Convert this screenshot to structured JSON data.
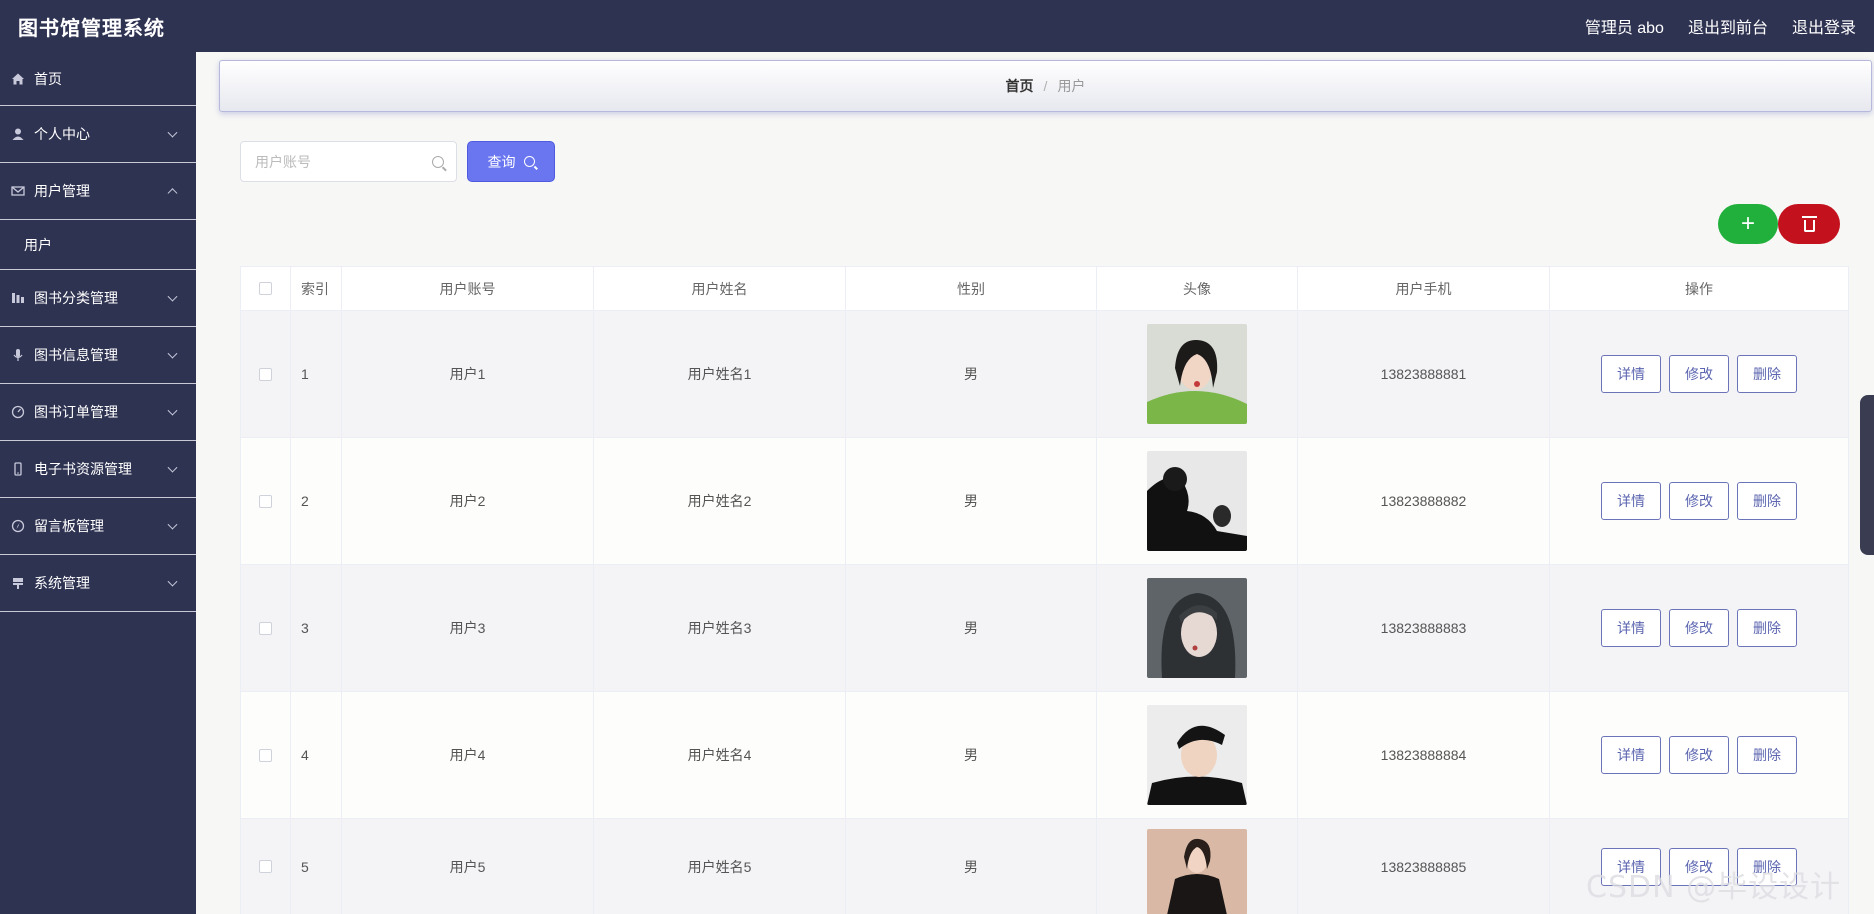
{
  "app": {
    "title": "图书馆管理系统",
    "admin_label": "管理员 abo",
    "to_front": "退出到前台",
    "logout": "退出登录"
  },
  "sidebar": {
    "items": [
      {
        "label": "首页",
        "icon": "home-icon"
      },
      {
        "label": "个人中心",
        "icon": "user-icon"
      },
      {
        "label": "用户管理",
        "icon": "mail-icon",
        "expanded": true
      },
      {
        "label": "图书分类管理",
        "icon": "chart-icon"
      },
      {
        "label": "图书信息管理",
        "icon": "mic-icon"
      },
      {
        "label": "图书订单管理",
        "icon": "gauge-icon"
      },
      {
        "label": "电子书资源管理",
        "icon": "phone-icon"
      },
      {
        "label": "留言板管理",
        "icon": "compass-icon"
      },
      {
        "label": "系统管理",
        "icon": "sign-icon"
      }
    ],
    "sub_item": "用户"
  },
  "breadcrumb": {
    "home": "首页",
    "sep": "/",
    "current": "用户"
  },
  "search": {
    "placeholder": "用户账号",
    "value": "",
    "button": "查询"
  },
  "table": {
    "headers": [
      "索引",
      "用户账号",
      "用户姓名",
      "性别",
      "头像",
      "用户手机",
      "操作"
    ],
    "rows": [
      {
        "index": "1",
        "account": "用户1",
        "name": "用户姓名1",
        "gender": "男",
        "phone": "13823888881"
      },
      {
        "index": "2",
        "account": "用户2",
        "name": "用户姓名2",
        "gender": "男",
        "phone": "13823888882"
      },
      {
        "index": "3",
        "account": "用户3",
        "name": "用户姓名3",
        "gender": "男",
        "phone": "13823888883"
      },
      {
        "index": "4",
        "account": "用户4",
        "name": "用户姓名4",
        "gender": "男",
        "phone": "13823888884"
      },
      {
        "index": "5",
        "account": "用户5",
        "name": "用户姓名5",
        "gender": "男",
        "phone": "13823888885"
      }
    ],
    "actions": {
      "detail": "详情",
      "edit": "修改",
      "delete": "删除"
    }
  },
  "buttons": {
    "add": "+"
  },
  "watermark": "CSDN @毕设设计",
  "colors": {
    "topbar": "#2f3352",
    "primary": "#6a75f0",
    "add": "#22b03d",
    "delete": "#c4111e"
  }
}
